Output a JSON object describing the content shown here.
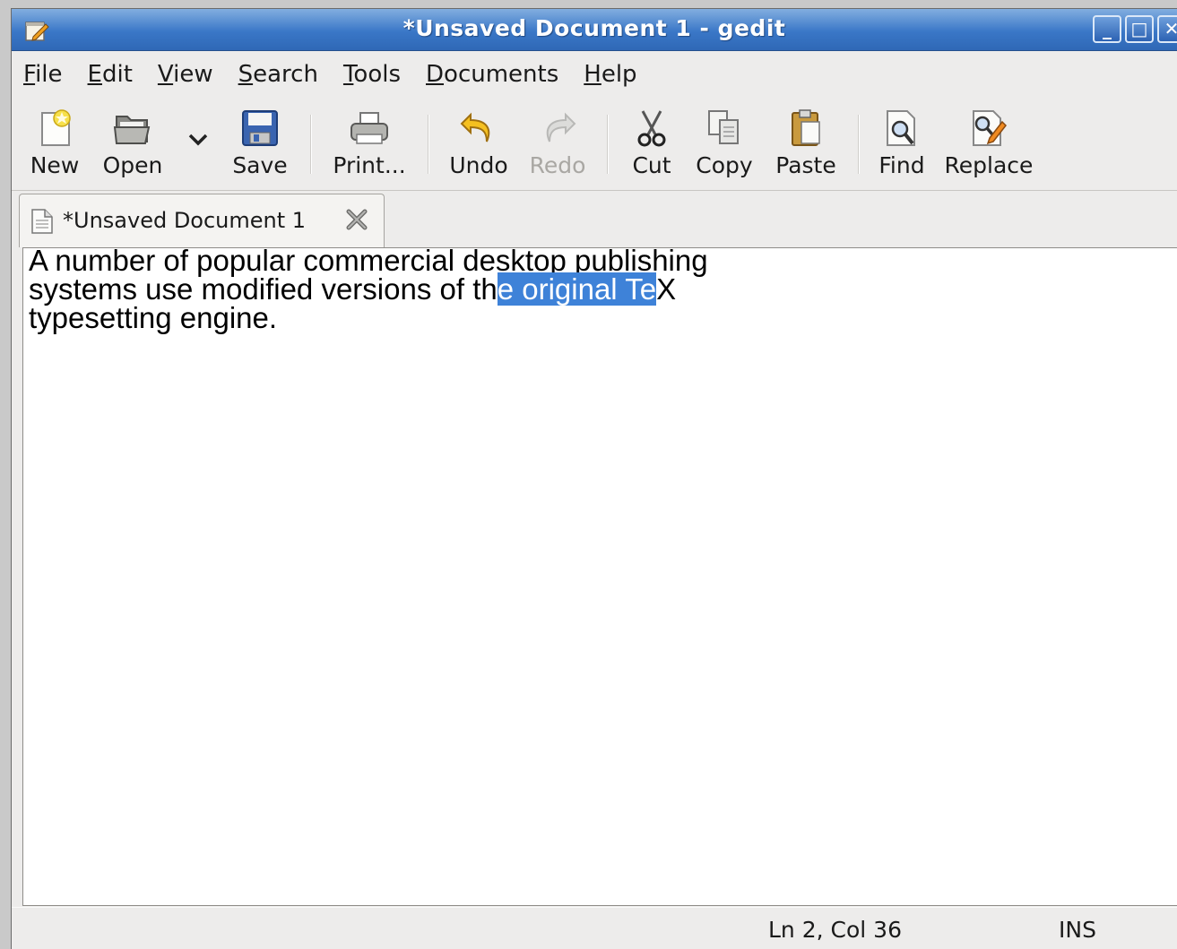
{
  "window": {
    "title": "*Unsaved Document 1 - gedit",
    "controls": {
      "minimize": "_",
      "maximize": "□",
      "close": "✕"
    }
  },
  "menu": [
    {
      "mnemonic": "F",
      "rest": "ile"
    },
    {
      "mnemonic": "E",
      "rest": "dit"
    },
    {
      "mnemonic": "V",
      "rest": "iew"
    },
    {
      "mnemonic": "S",
      "rest": "earch"
    },
    {
      "mnemonic": "T",
      "rest": "ools"
    },
    {
      "mnemonic": "D",
      "rest": "ocuments"
    },
    {
      "mnemonic": "H",
      "rest": "elp"
    }
  ],
  "toolbar": {
    "new": "New",
    "open": "Open",
    "save": "Save",
    "print": "Print...",
    "undo": "Undo",
    "redo": "Redo",
    "cut": "Cut",
    "copy": "Copy",
    "paste": "Paste",
    "find": "Find",
    "replace": "Replace"
  },
  "tab": {
    "label": "*Unsaved Document 1"
  },
  "editor": {
    "before_selection": "A number of popular commercial desktop publishing\nsystems use modified versions of th",
    "selection": "e original Te",
    "after_selection": "X\ntypesetting engine."
  },
  "status": {
    "position": "Ln 2, Col 36",
    "mode": "INS"
  },
  "colors": {
    "titlebar": "#3a77c7",
    "selection": "#3e82d8"
  }
}
